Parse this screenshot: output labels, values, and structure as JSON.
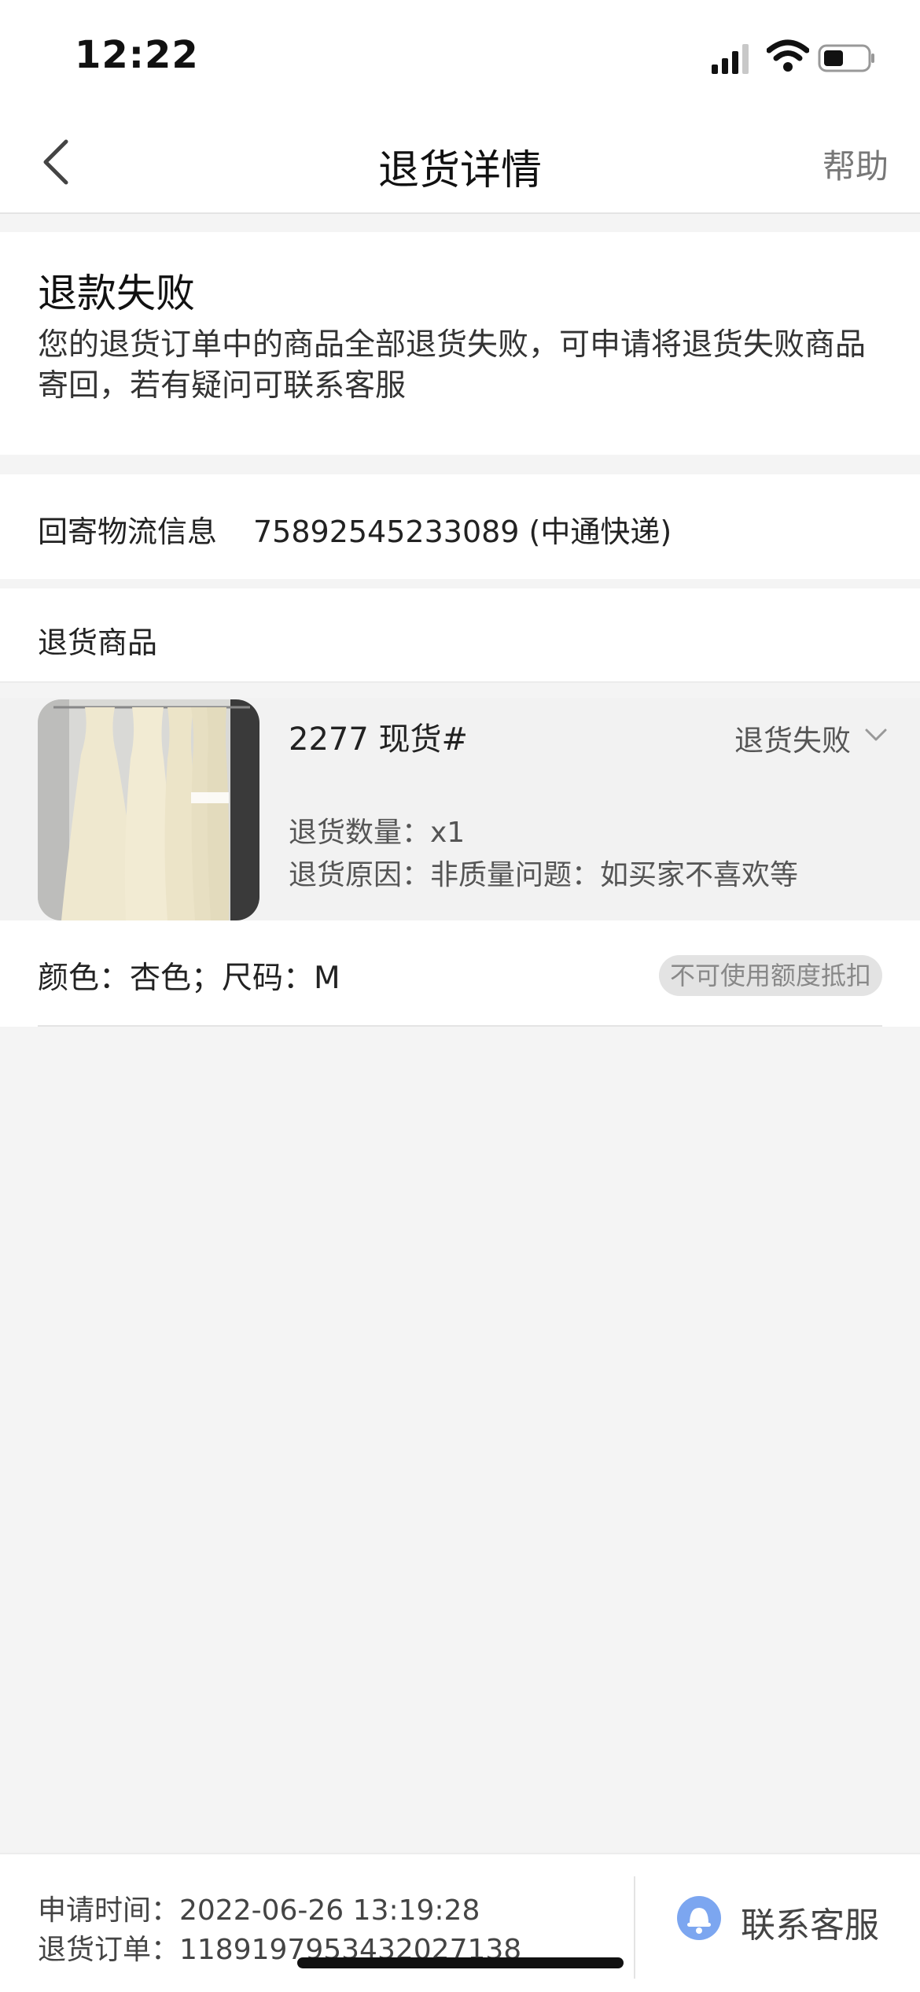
{
  "status_bar": {
    "time": "12:22"
  },
  "nav": {
    "title": "退货详情",
    "help": "帮助"
  },
  "refund_status": {
    "title": "退款失败",
    "description": "您的退货订单中的商品全部退货失败，可申请将退货失败商品寄回，若有疑问可联系客服"
  },
  "logistics": {
    "label": "回寄物流信息",
    "value": "75892545233089 (中通快递)"
  },
  "goods": {
    "header": "退货商品",
    "item": {
      "name": "2277 现货#",
      "status": "退货失败",
      "quantity": "退货数量：x1",
      "reason": "退货原因：非质量问题：如买家不喜欢等",
      "spec": "颜色：杏色；尺码：M",
      "badge": "不可使用额度抵扣"
    }
  },
  "footer": {
    "apply_time": "申请时间：2022-06-26 13:19:28",
    "return_order": "退货订单：1189197953432027138",
    "contact": "联系客服"
  },
  "colors": {
    "accent_blue": "#7ca6f0",
    "background": "#f4f4f4"
  }
}
